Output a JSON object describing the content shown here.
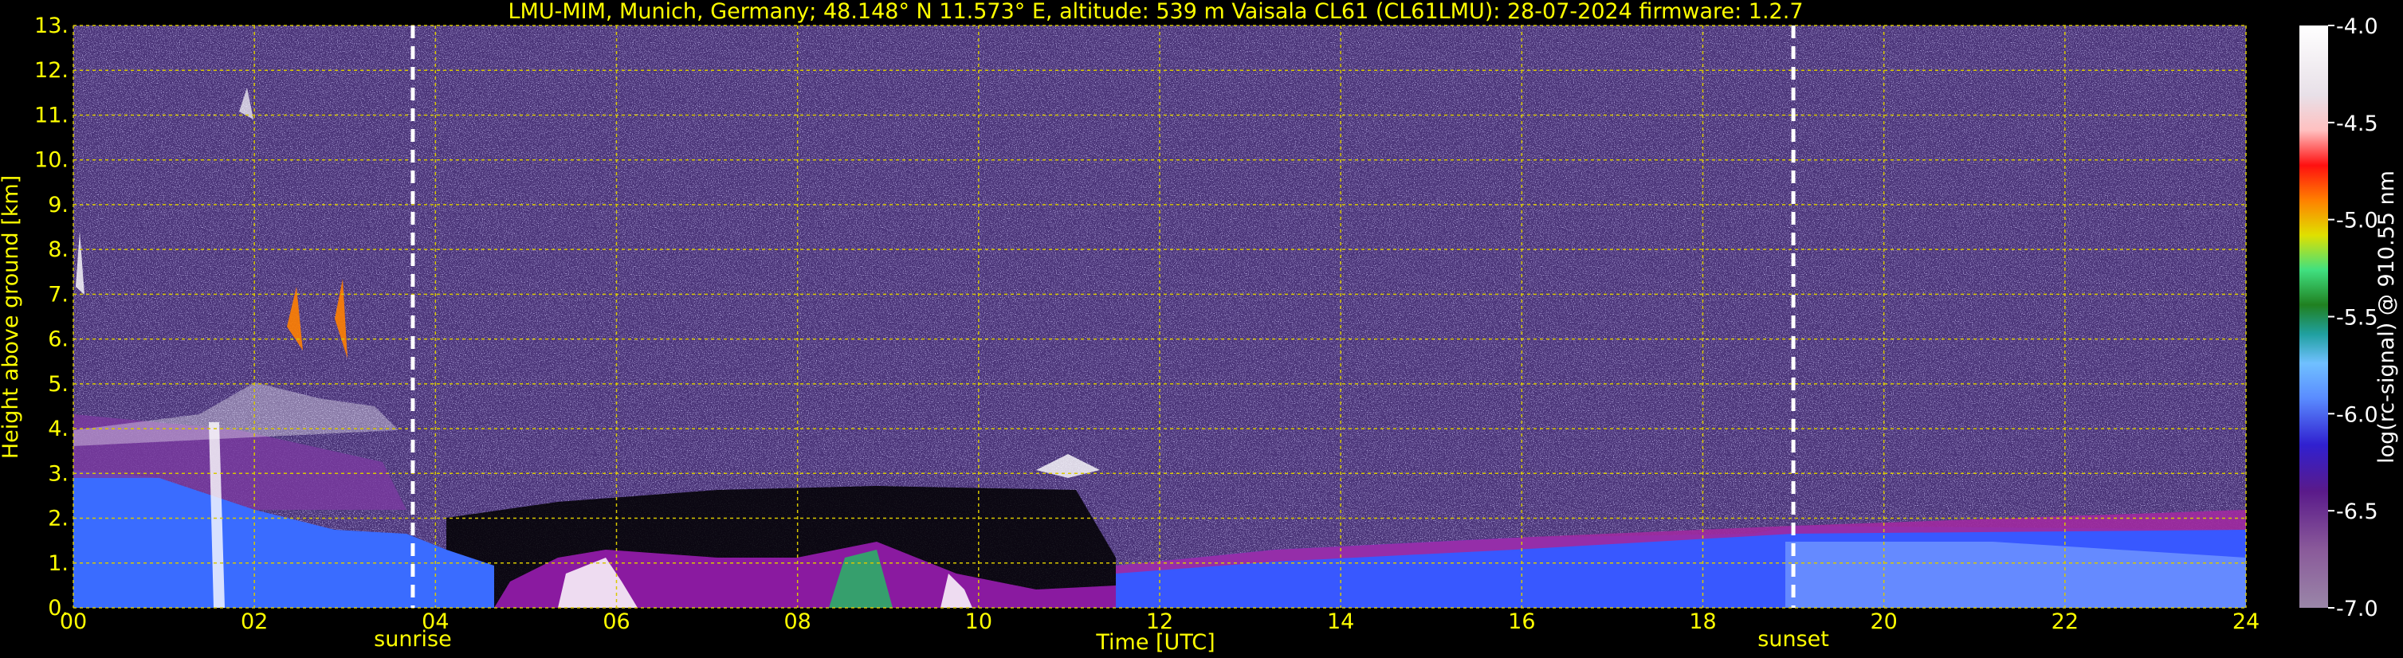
{
  "chart_data": {
    "type": "heatmap",
    "title": "LMU-MIM, Munich, Germany; 48.148° N 11.573° E, altitude: 539 m    Vaisala CL61 (CL61LMU): 28-07-2024    firmware: 1.2.7",
    "xlabel": "Time [UTC]",
    "ylabel": "Height above ground [km]",
    "xlim": [
      0,
      24
    ],
    "ylim": [
      0,
      13
    ],
    "x_ticks": [
      "00",
      "02",
      "04",
      "06",
      "08",
      "10",
      "12",
      "14",
      "16",
      "18",
      "20",
      "22",
      "24"
    ],
    "y_ticks": [
      "0.",
      "1.",
      "2.",
      "3.",
      "4.",
      "5.",
      "6.",
      "7.",
      "8.",
      "9.",
      "10.",
      "11.",
      "12.",
      "13."
    ],
    "grid": true,
    "events": [
      {
        "label": "sunrise",
        "time": 3.75
      },
      {
        "label": "sunset",
        "time": 19.0
      }
    ],
    "colorbar": {
      "label": "log(rc-signal) @ 910.55 nm",
      "range": [
        -7.0,
        -4.0
      ],
      "ticks": [
        "-7.0",
        "-6.5",
        "-6.0",
        "-5.5",
        "-5.0",
        "-4.5",
        "-4.0"
      ]
    },
    "colors": {
      "background": "#000000",
      "text": "#ffff00",
      "grid": "#d8c800",
      "noise": "#5a3f8c",
      "boundary_layer": "#3a6cff",
      "event_line": "#ffffff"
    }
  }
}
